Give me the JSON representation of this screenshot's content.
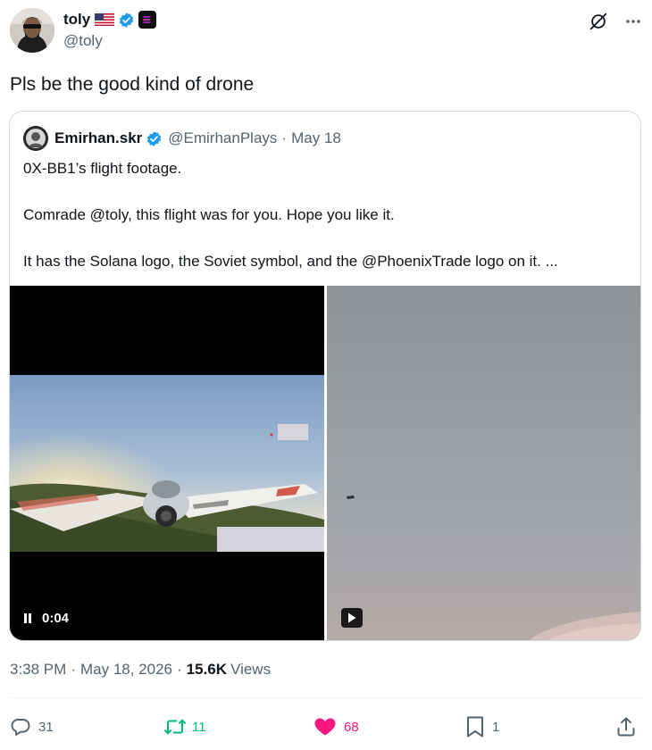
{
  "author": {
    "name": "toly",
    "handle": "@toly"
  },
  "tweet": {
    "text": "Pls be the good kind of drone"
  },
  "quote": {
    "name": "Emirhan.skr",
    "handle": "@EmirhanPlays",
    "separator": "·",
    "date": "May 18",
    "lines": [
      "0X-BB1’s flight footage.",
      "Comrade @toly, this flight was for you. Hope you like it.",
      "It has the Solana logo, the Soviet symbol, and the @PhoenixTrade logo on it. ..."
    ],
    "video_time": "0:04"
  },
  "meta": {
    "time": "3:38 PM",
    "separator": "·",
    "date": "May 18, 2026",
    "views_count": "15.6K",
    "views_label": "Views"
  },
  "actions": {
    "replies": "31",
    "reposts": "11",
    "likes": "68",
    "bookmarks": "1"
  },
  "colors": {
    "like": "#f91880",
    "repost": "#00ba7c",
    "verified": "#1d9bf0",
    "secondary_text": "#536471"
  },
  "icons": [
    "grok-icon",
    "more-icon",
    "reply-icon",
    "repost-icon",
    "like-icon",
    "bookmark-icon",
    "share-icon",
    "verified-icon",
    "us-flag-icon",
    "solana-badge-icon",
    "pause-icon",
    "play-icon"
  ]
}
